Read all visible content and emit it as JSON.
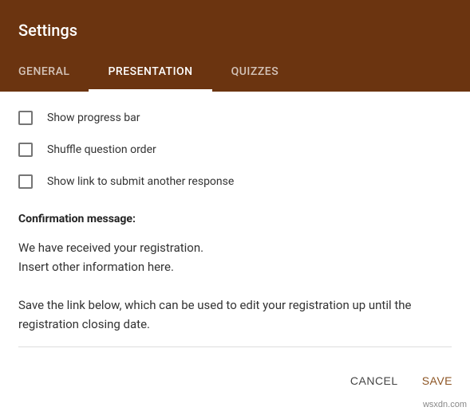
{
  "dialog": {
    "title": "Settings",
    "tabs": [
      {
        "label": "GENERAL",
        "active": false
      },
      {
        "label": "PRESENTATION",
        "active": true
      },
      {
        "label": "QUIZZES",
        "active": false
      }
    ]
  },
  "presentation": {
    "options": [
      {
        "label": "Show progress bar",
        "checked": false
      },
      {
        "label": "Shuffle question order",
        "checked": false
      },
      {
        "label": "Show link to submit another response",
        "checked": false
      }
    ],
    "confirmation_title": "Confirmation message:",
    "confirmation_message": "We have received your registration.\nInsert other information here.\n\nSave the link below, which can be used to edit your registration up until the registration closing date."
  },
  "actions": {
    "cancel_label": "CANCEL",
    "save_label": "SAVE"
  },
  "watermark": "wsxdn.com"
}
